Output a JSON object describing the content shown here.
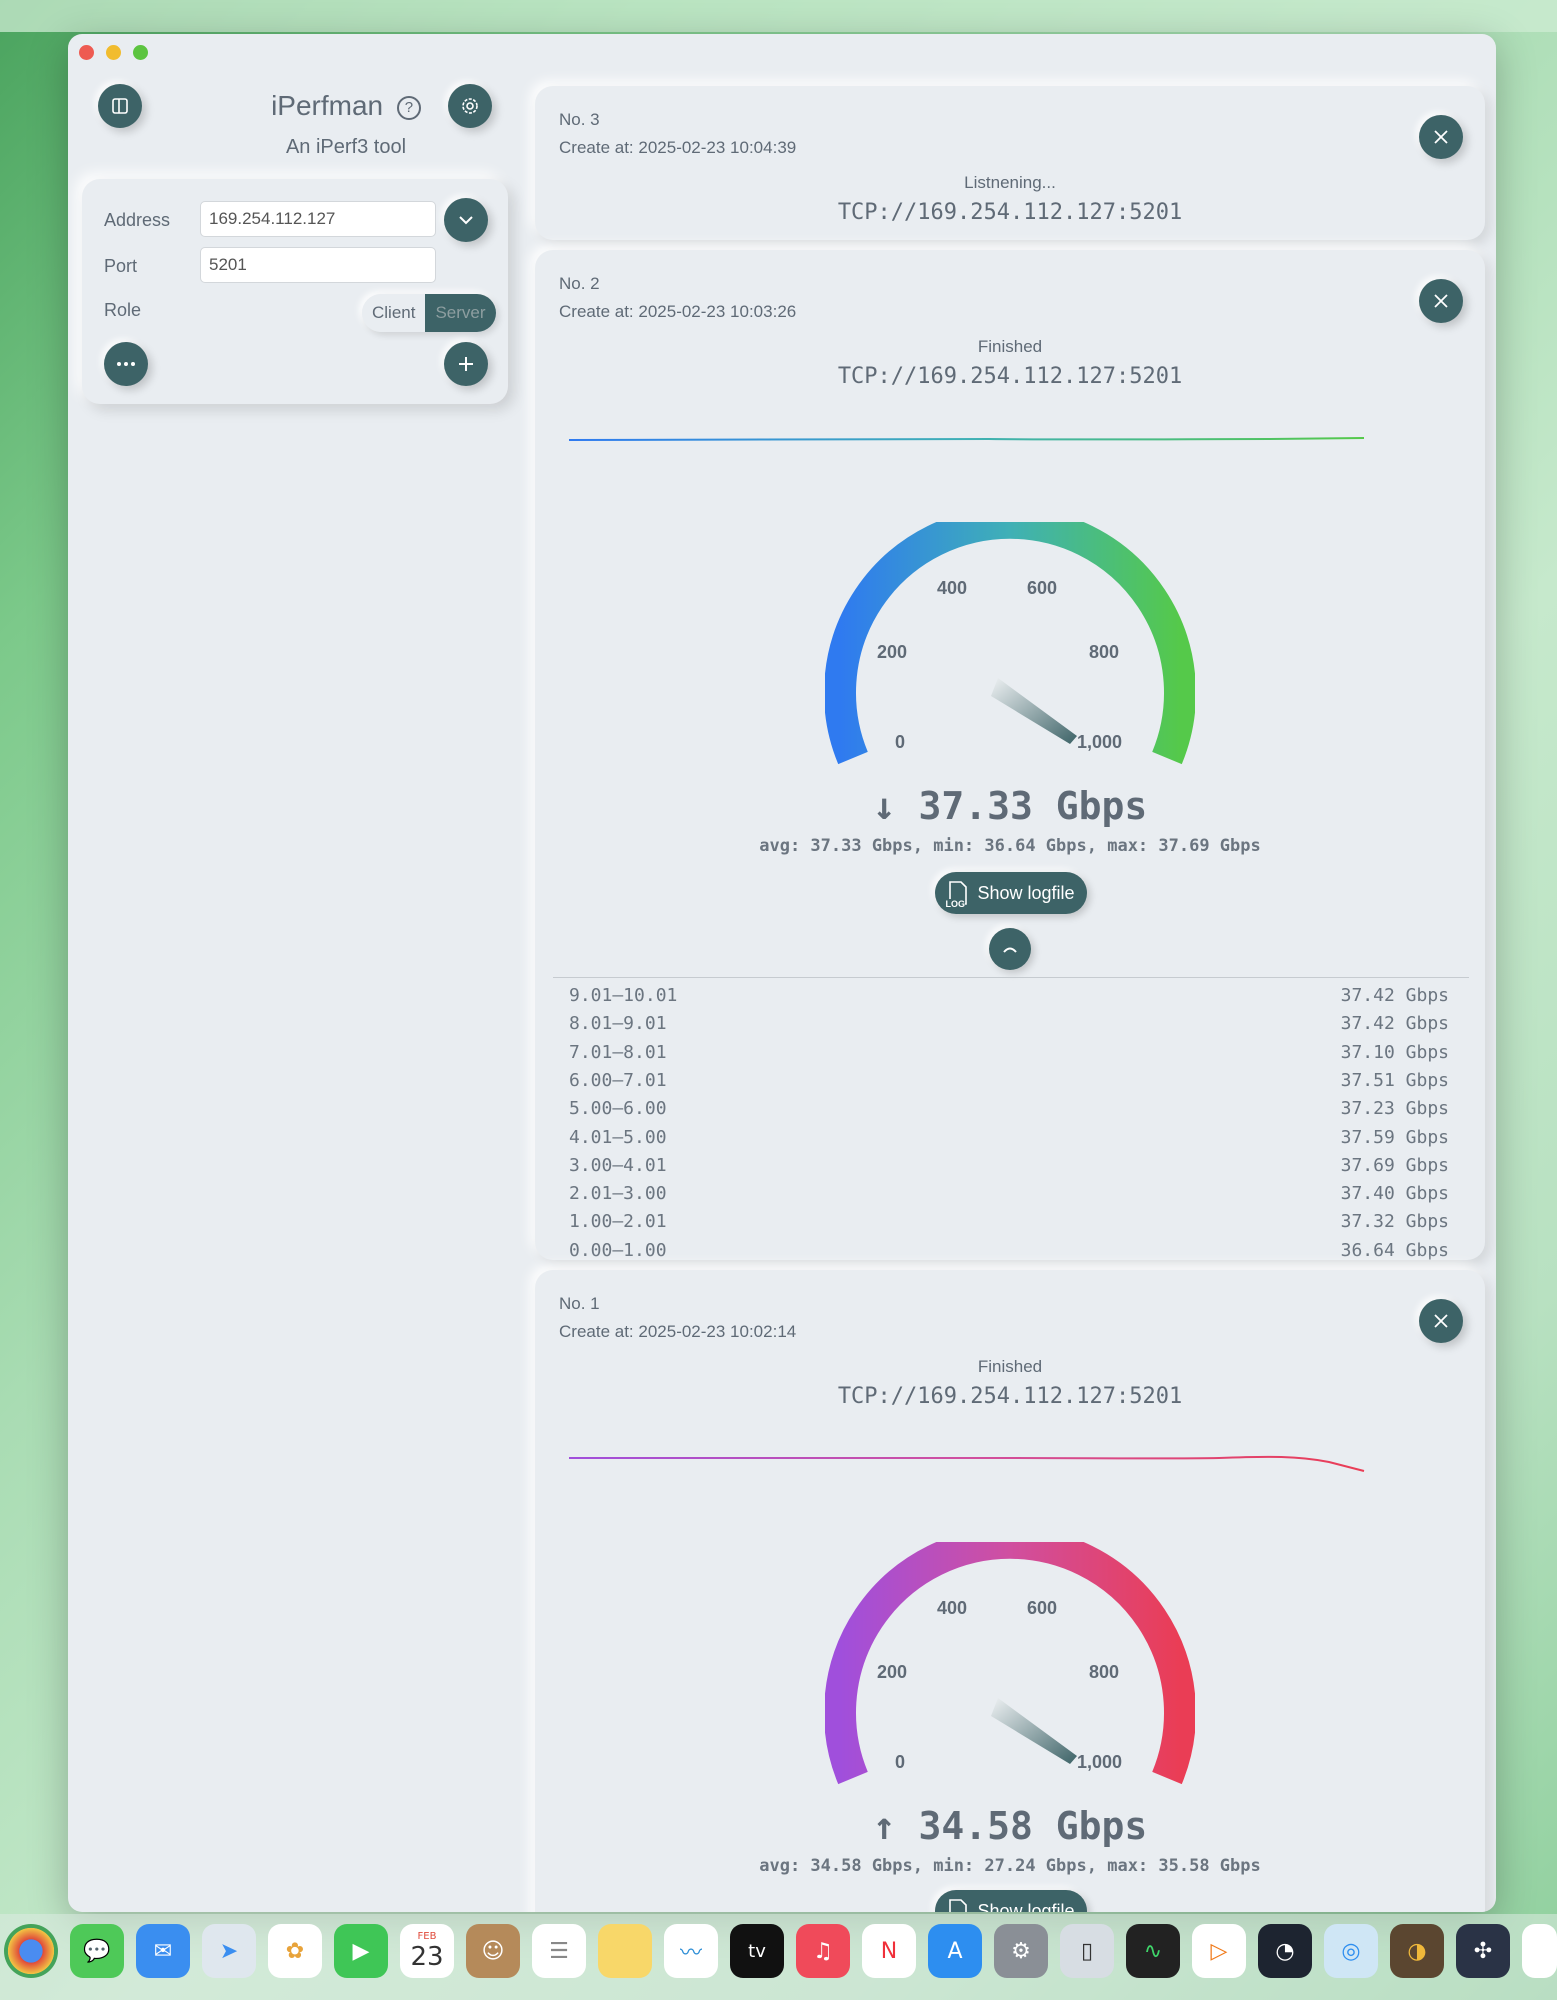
{
  "app": {
    "title": "iPerfman",
    "subtitle": "An iPerf3 tool"
  },
  "form": {
    "address_label": "Address",
    "address_value": "169.254.112.127",
    "port_label": "Port",
    "port_value": "5201",
    "role_label": "Role",
    "role_options": [
      "Client",
      "Server"
    ],
    "role_selected": "Server"
  },
  "sessions": [
    {
      "number": "No. 3",
      "created": "Create at: 2025-02-23 10:04:39",
      "status": "Listnening...",
      "address": "TCP://169.254.112.127:5201"
    },
    {
      "number": "No. 2",
      "created": "Create at: 2025-02-23 10:03:26",
      "status": "Finished",
      "address": "TCP://169.254.112.127:5201",
      "speed": "37.33 Gbps",
      "direction": "down",
      "stats": "avg: 37.33 Gbps, min: 36.64 Gbps, max: 37.69 Gbps",
      "logfile_label": "Show logfile",
      "gauge_ticks": [
        "0",
        "200",
        "400",
        "600",
        "800",
        "1,000"
      ],
      "gauge_colors": [
        "#2f7af0",
        "#3fb0b6",
        "#55c94a"
      ],
      "intervals": [
        {
          "range": "9.01–10.01",
          "value": "37.42 Gbps"
        },
        {
          "range": "8.01–9.01",
          "value": "37.42 Gbps"
        },
        {
          "range": "7.01–8.01",
          "value": "37.10 Gbps"
        },
        {
          "range": "6.00–7.01",
          "value": "37.51 Gbps"
        },
        {
          "range": "5.00–6.00",
          "value": "37.23 Gbps"
        },
        {
          "range": "4.01–5.00",
          "value": "37.59 Gbps"
        },
        {
          "range": "3.00–4.01",
          "value": "37.69 Gbps"
        },
        {
          "range": "2.01–3.00",
          "value": "37.40 Gbps"
        },
        {
          "range": "1.00–2.01",
          "value": "37.32 Gbps"
        },
        {
          "range": "0.00–1.00",
          "value": "36.64 Gbps"
        }
      ]
    },
    {
      "number": "No. 1",
      "created": "Create at: 2025-02-23 10:02:14",
      "status": "Finished",
      "address": "TCP://169.254.112.127:5201",
      "speed": "34.58 Gbps",
      "direction": "up",
      "stats": "avg: 34.58 Gbps, min: 27.24 Gbps, max: 35.58 Gbps",
      "logfile_label": "Show logfile",
      "gauge_ticks": [
        "0",
        "200",
        "400",
        "600",
        "800",
        "1,000"
      ],
      "gauge_colors": [
        "#a04fdc",
        "#d04fa0",
        "#ea3d55"
      ]
    }
  ],
  "logo_badge": "LOG",
  "dock": {
    "calendar_month": "FEB",
    "calendar_day": "23",
    "tv_label": "tv"
  }
}
